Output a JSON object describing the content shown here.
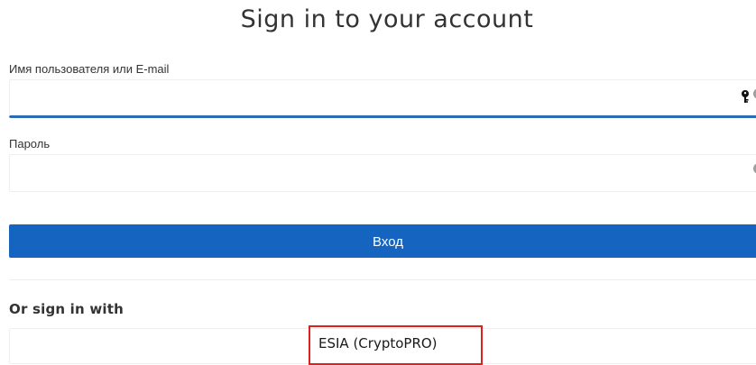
{
  "header": {
    "title": "Sign in to your account"
  },
  "form": {
    "username": {
      "label": "Имя пользователя или E-mail",
      "value": "",
      "icons": [
        "key-black-icon",
        "key-grey-icon"
      ]
    },
    "password": {
      "label": "Пароль",
      "value": "",
      "icons": [
        "key-grey-icon"
      ]
    },
    "submit_label": "Вход"
  },
  "alternative": {
    "heading": "Or sign in with",
    "providers": [
      {
        "label": "ESIA (CryptoPRO)"
      }
    ]
  },
  "colors": {
    "primary": "#1565c0",
    "focus_underline": "#2b6cb5",
    "highlight": "#e01f1f",
    "text": "#333333"
  }
}
